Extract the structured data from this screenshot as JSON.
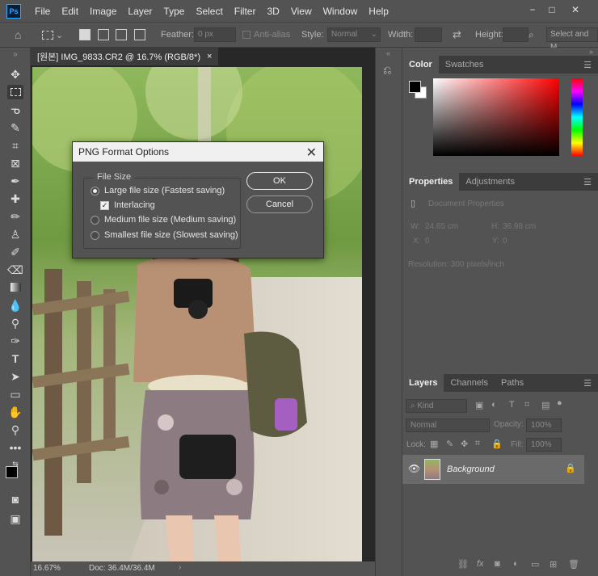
{
  "app": {
    "logo": "Ps"
  },
  "menu": [
    "File",
    "Edit",
    "Image",
    "Layer",
    "Type",
    "Select",
    "Filter",
    "3D",
    "View",
    "Window",
    "Help"
  ],
  "window_controls": {
    "minimize": "−",
    "maximize": "□",
    "close": "✕"
  },
  "options_bar": {
    "feather_label": "Feather:",
    "feather_value": "0 px",
    "anti_alias_label": "Anti-alias",
    "style_label": "Style:",
    "style_value": "Normal",
    "width_label": "Width:",
    "height_label": "Height:",
    "select_mask": "Select and M"
  },
  "document": {
    "tab_title": "[원본] IMG_9833.CR2 @ 16.7% (RGB/8*)",
    "tab_close": "×",
    "zoom": "16.67%",
    "doc_size": "Doc: 36.4M/36.4M"
  },
  "dialog": {
    "title": "PNG Format Options",
    "close": "✕",
    "group_label": "File Size",
    "options": [
      {
        "label": "Large file size (Fastest saving)",
        "selected": true
      },
      {
        "label": "Medium file size (Medium saving)",
        "selected": false
      },
      {
        "label": "Smallest file size (Slowest saving)",
        "selected": false
      }
    ],
    "interlacing_label": "Interlacing",
    "interlacing_checked": true,
    "ok_label": "OK",
    "cancel_label": "Cancel"
  },
  "color_panel": {
    "tabs": [
      "Color",
      "Swatches"
    ],
    "accent": "#ff0000"
  },
  "properties_panel": {
    "tabs": [
      "Properties",
      "Adjustments"
    ],
    "section": "Document Properties",
    "w_label": "W:",
    "w_value": "24.65 cm",
    "h_label": "H:",
    "h_value": "36.98 cm",
    "x_label": "X:",
    "x_value": "0",
    "y_label": "Y:",
    "y_value": "0",
    "resolution": "Resolution: 300 pixels/inch"
  },
  "layers_panel": {
    "tabs": [
      "Layers",
      "Channels",
      "Paths"
    ],
    "kind": "Kind",
    "blend_mode": "Normal",
    "opacity_label": "Opacity:",
    "opacity_value": "100%",
    "lock_label": "Lock:",
    "fill_label": "Fill:",
    "fill_value": "100%",
    "layer_name": "Background"
  }
}
